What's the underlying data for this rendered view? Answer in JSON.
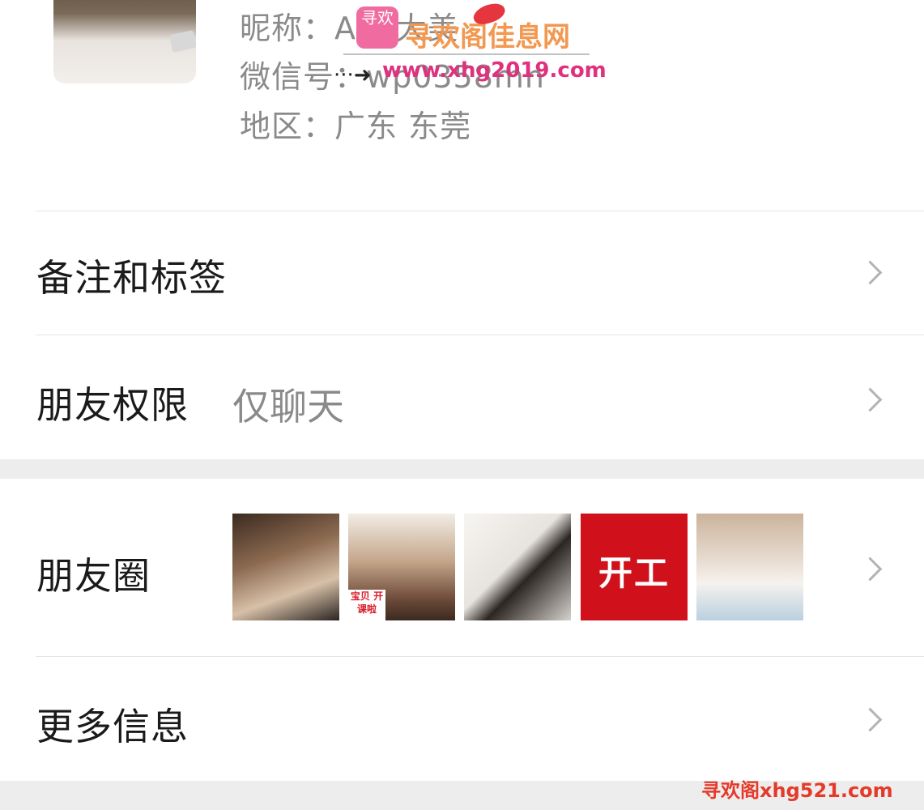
{
  "profile": {
    "nickname_line": "昵称：Aaa大美",
    "wechat_line": "微信号：wp0358mn",
    "region_line": "地区：广东 东莞"
  },
  "watermark": {
    "logo_text": "寻欢",
    "title": "寻欢阁佳息网",
    "url": "www.xhg2019.com",
    "arrow": "···➜",
    "bottom_text": "寻欢阁xhg521.com"
  },
  "rows": {
    "remarks": {
      "label": "备注和标签"
    },
    "permissions": {
      "label": "朋友权限",
      "value": "仅聊天"
    },
    "moments": {
      "label": "朋友圈",
      "thumb2_sticker": "宝贝 开课啦",
      "thumb4_text": "开工"
    },
    "more_info": {
      "label": "更多信息"
    }
  },
  "colors": {
    "background": "#ffffff",
    "section_gap": "#ededed",
    "separator": "#e5e5e5",
    "secondary_text": "#8a8a8a",
    "chevron": "#b3b3b3"
  }
}
